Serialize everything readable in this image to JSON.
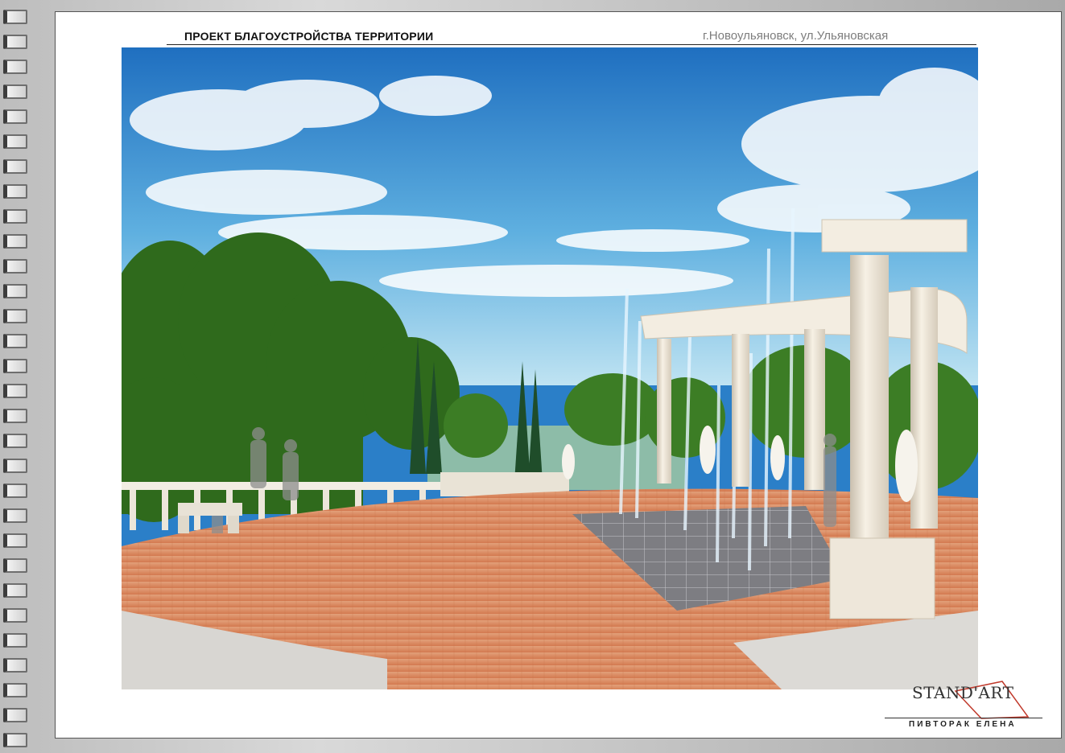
{
  "header": {
    "project_title": "ПРОЕКТ БЛАГОУСТРОЙСТВА ТЕРРИТОРИИ",
    "location": "г.Новоульяновск, ул.Ульяновская"
  },
  "logo": {
    "wordmark": "STAND'ART",
    "author": "ПИВТОРАК  ЕЛЕНА"
  },
  "colors": {
    "sky": "#2f86cf",
    "paving": "#d9845a",
    "column": "#efe7d8",
    "foliage": "#2f6a1c",
    "logo_accent": "#c0392b"
  }
}
